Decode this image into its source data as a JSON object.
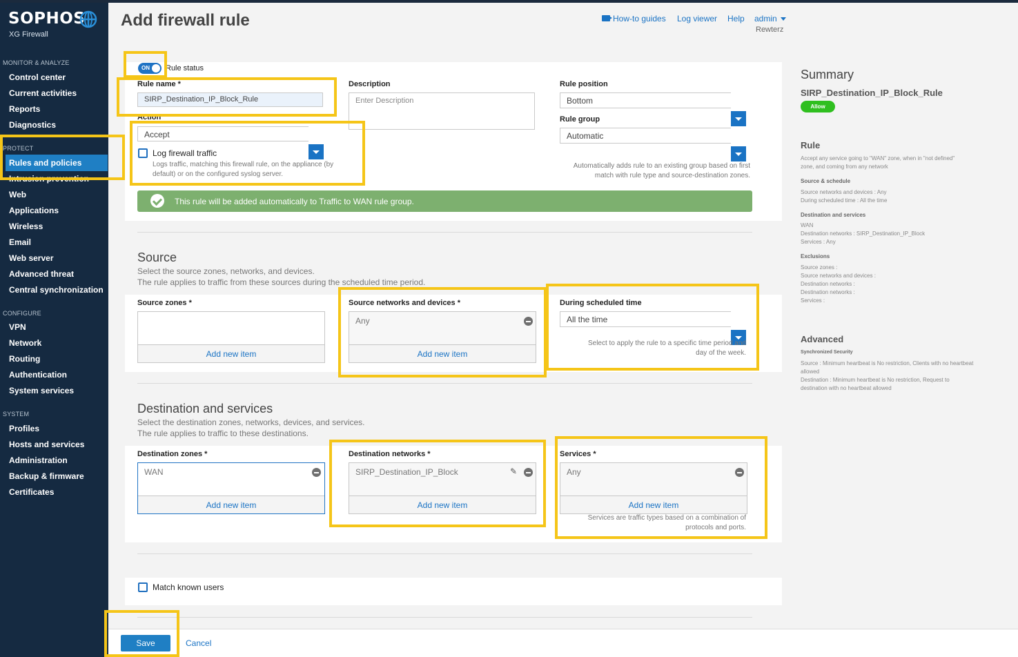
{
  "sidebar": {
    "logo": "SOPHOS",
    "logo_sub": "XG Firewall",
    "sections": {
      "monitor": "MONITOR & ANALYZE",
      "protect": "PROTECT",
      "configure": "CONFIGURE",
      "system": "SYSTEM"
    },
    "monitor_items": [
      "Control center",
      "Current activities",
      "Reports",
      "Diagnostics"
    ],
    "protect_items": [
      "Rules and policies",
      "Intrusion prevention",
      "Web",
      "Applications",
      "Wireless",
      "Email",
      "Web server",
      "Advanced threat",
      "Central synchronization"
    ],
    "configure_items": [
      "VPN",
      "Network",
      "Routing",
      "Authentication",
      "System services"
    ],
    "system_items": [
      "Profiles",
      "Hosts and services",
      "Administration",
      "Backup & firmware",
      "Certificates"
    ]
  },
  "header": {
    "title": "Add firewall rule",
    "howto": "How-to guides",
    "logviewer": "Log viewer",
    "help": "Help",
    "user": "admin",
    "device": "Rewterz"
  },
  "rule": {
    "toggle": "ON",
    "status_label": "Rule status",
    "name_label": "Rule name *",
    "name_value": "SIRP_Destination_IP_Block_Rule",
    "desc_label": "Description",
    "desc_placeholder": "Enter Description",
    "position_label": "Rule position",
    "position_value": "Bottom",
    "group_label": "Rule group",
    "group_value": "Automatic",
    "group_hint": "Automatically adds rule to an existing group based on first match with rule type and source-destination zones.",
    "action_label": "Action",
    "action_value": "Accept",
    "log_label": "Log firewall traffic",
    "log_hint": "Logs traffic, matching this firewall rule, on the appliance (by default) or on the configured syslog server.",
    "banner": "This rule will be added automatically to Traffic to WAN rule group."
  },
  "source": {
    "title": "Source",
    "desc1": "Select the source zones, networks, and devices.",
    "desc2": "The rule applies to traffic from these sources during the scheduled time period.",
    "zones_label": "Source zones *",
    "networks_label": "Source networks and devices *",
    "networks_value": "Any",
    "schedule_label": "During scheduled time",
    "schedule_value": "All the time",
    "schedule_hint": "Select to apply the rule to a specific time period and day of the week.",
    "add_new": "Add new item"
  },
  "destination": {
    "title": "Destination and services",
    "desc1": "Select the destination zones, networks, devices, and services.",
    "desc2": "The rule applies to traffic to these destinations.",
    "zones_label": "Destination zones *",
    "zones_value": "WAN",
    "networks_label": "Destination networks *",
    "networks_value": "SIRP_Destination_IP_Block",
    "services_label": "Services *",
    "services_value": "Any",
    "services_hint": "Services are traffic types based on a combination of protocols and ports.",
    "add_new": "Add new item"
  },
  "match_users": "Match known users",
  "footer": {
    "save": "Save",
    "cancel": "Cancel"
  },
  "summary": {
    "title": "Summary",
    "rule_name": "SIRP_Destination_IP_Block_Rule",
    "badge": "Allow",
    "rule_head": "Rule",
    "rule_desc": "Accept any service going to \"WAN\" zone, when in \"not defined\" zone, and coming from any network",
    "src_head": "Source & schedule",
    "src_line1": "Source networks and devices : Any",
    "src_line2": "During scheduled time : All the time",
    "dst_head": "Destination and services",
    "dst_line1": "WAN",
    "dst_line2": "Destination networks : SIRP_Destination_IP_Block",
    "dst_line3": "Services : Any",
    "exc_head": "Exclusions",
    "exc_line1": "Source zones :",
    "exc_line2": "Source networks and devices :",
    "exc_line3": "Destination networks :",
    "exc_line4": "Destination networks :",
    "exc_line5": "Services :",
    "adv_head": "Advanced",
    "sync_head": "Synchronized Security",
    "sync_src": "Source : Minimum heartbeat is No restriction, Clients with no heartbeat allowed",
    "sync_dst": "Destination : Minimum heartbeat is No restriction, Request to destination with no heartbeat allowed"
  },
  "colors": {
    "sidebar": "#152a41",
    "accent": "#1f7fc4",
    "highlight": "#f5c518",
    "banner": "#7db06f",
    "allow": "#2fbf1f"
  }
}
